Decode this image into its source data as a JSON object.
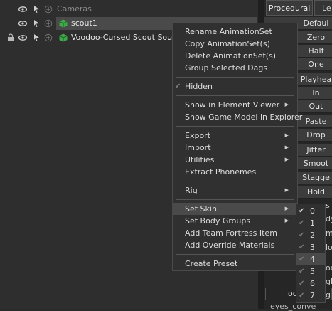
{
  "tree": {
    "rows": [
      {
        "label": "Cameras",
        "locked": false,
        "selected": false,
        "has_model_icon": false
      },
      {
        "label": "scout1",
        "locked": false,
        "selected": true,
        "has_model_icon": true
      },
      {
        "label": "Voodoo-Cursed Scout Soul",
        "locked": true,
        "selected": false,
        "has_model_icon": true
      }
    ]
  },
  "right_panel": {
    "tabs": [
      "Procedural",
      "Le"
    ],
    "buttons": [
      "Defaul",
      "Zero",
      "Half",
      "One",
      "Playhea",
      "In",
      "Out",
      "Paste",
      "Drop",
      "Jitter",
      "Smoot",
      "Stagge",
      "Hold"
    ],
    "partial_texts": [
      "s",
      "dy",
      "mp",
      "lo",
      "od",
      "gh",
      "ge",
      "ge",
      "loc",
      "eyes_conve"
    ]
  },
  "context_menu": {
    "groups": [
      [
        {
          "label": "Rename AnimationSet"
        },
        {
          "label": "Copy AnimationSet(s)"
        },
        {
          "label": "Delete AnimationSet(s)"
        },
        {
          "label": "Group Selected Dags"
        }
      ],
      [
        {
          "label": "Hidden",
          "checkable": true
        }
      ],
      [
        {
          "label": "Show in Element Viewer",
          "submenu": true
        },
        {
          "label": "Show Game Model in Explorer"
        }
      ],
      [
        {
          "label": "Export",
          "submenu": true
        },
        {
          "label": "Import",
          "submenu": true
        },
        {
          "label": "Utilities",
          "submenu": true
        },
        {
          "label": "Extract Phonemes"
        }
      ],
      [
        {
          "label": "Rig",
          "submenu": true
        }
      ],
      [
        {
          "label": "Set Skin",
          "submenu": true,
          "highlighted": true
        },
        {
          "label": "Set Body Groups",
          "submenu": true
        },
        {
          "label": "Add Team Fortress Item"
        },
        {
          "label": "Add Override Materials"
        }
      ],
      [
        {
          "label": "Create Preset"
        }
      ]
    ]
  },
  "skin_submenu": {
    "items": [
      "0",
      "1",
      "2",
      "3",
      "4",
      "5",
      "6",
      "7"
    ],
    "checked": "0",
    "highlighted": "4"
  },
  "colors": {
    "selection": "#4a4a4a",
    "model_icon": "#3fa84a"
  }
}
